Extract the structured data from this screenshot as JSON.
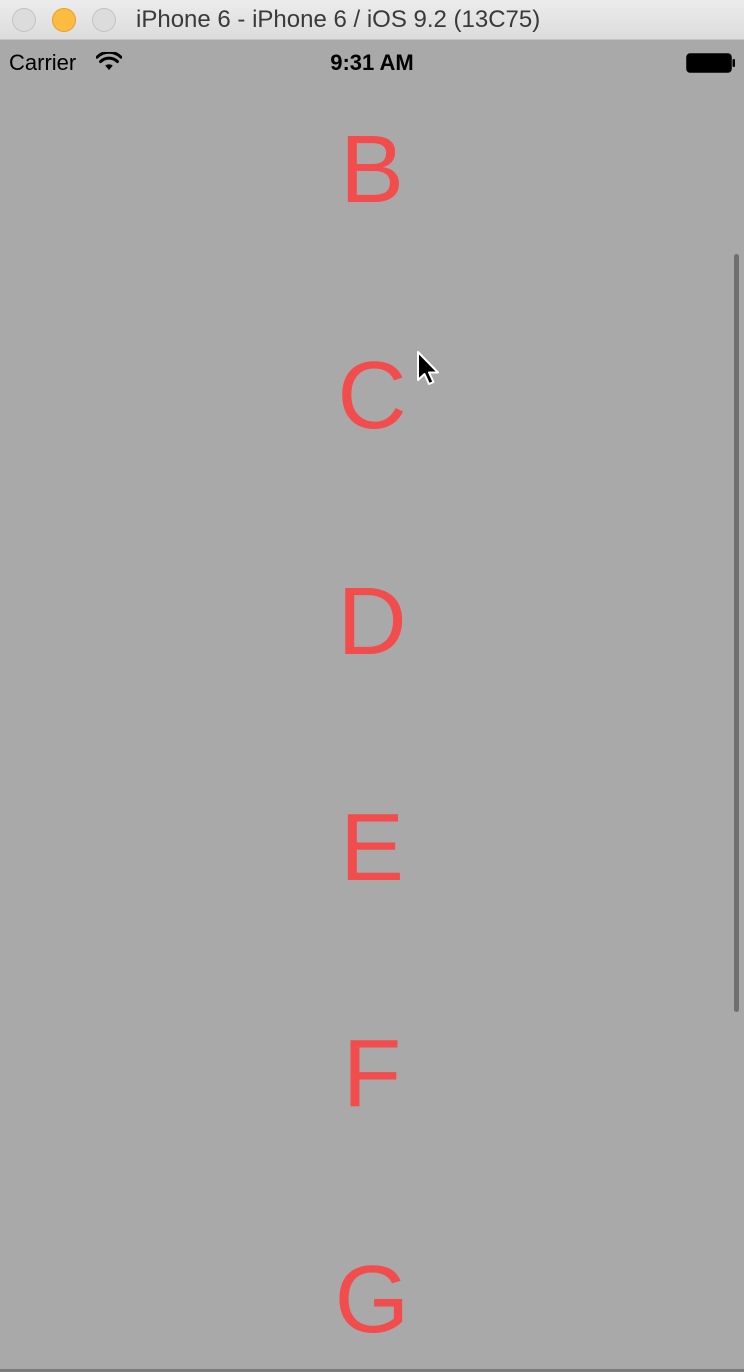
{
  "window": {
    "title": "iPhone 6 - iPhone 6 / iOS 9.2 (13C75)"
  },
  "status_bar": {
    "carrier": "Carrier",
    "time": "9:31 AM",
    "wifi_icon": "wifi-icon",
    "battery_icon": "battery-icon"
  },
  "list": {
    "items": [
      "B",
      "C",
      "D",
      "E",
      "F",
      "G"
    ]
  },
  "colors": {
    "background": "#a9a9a9",
    "letter": "#f24c4c"
  }
}
